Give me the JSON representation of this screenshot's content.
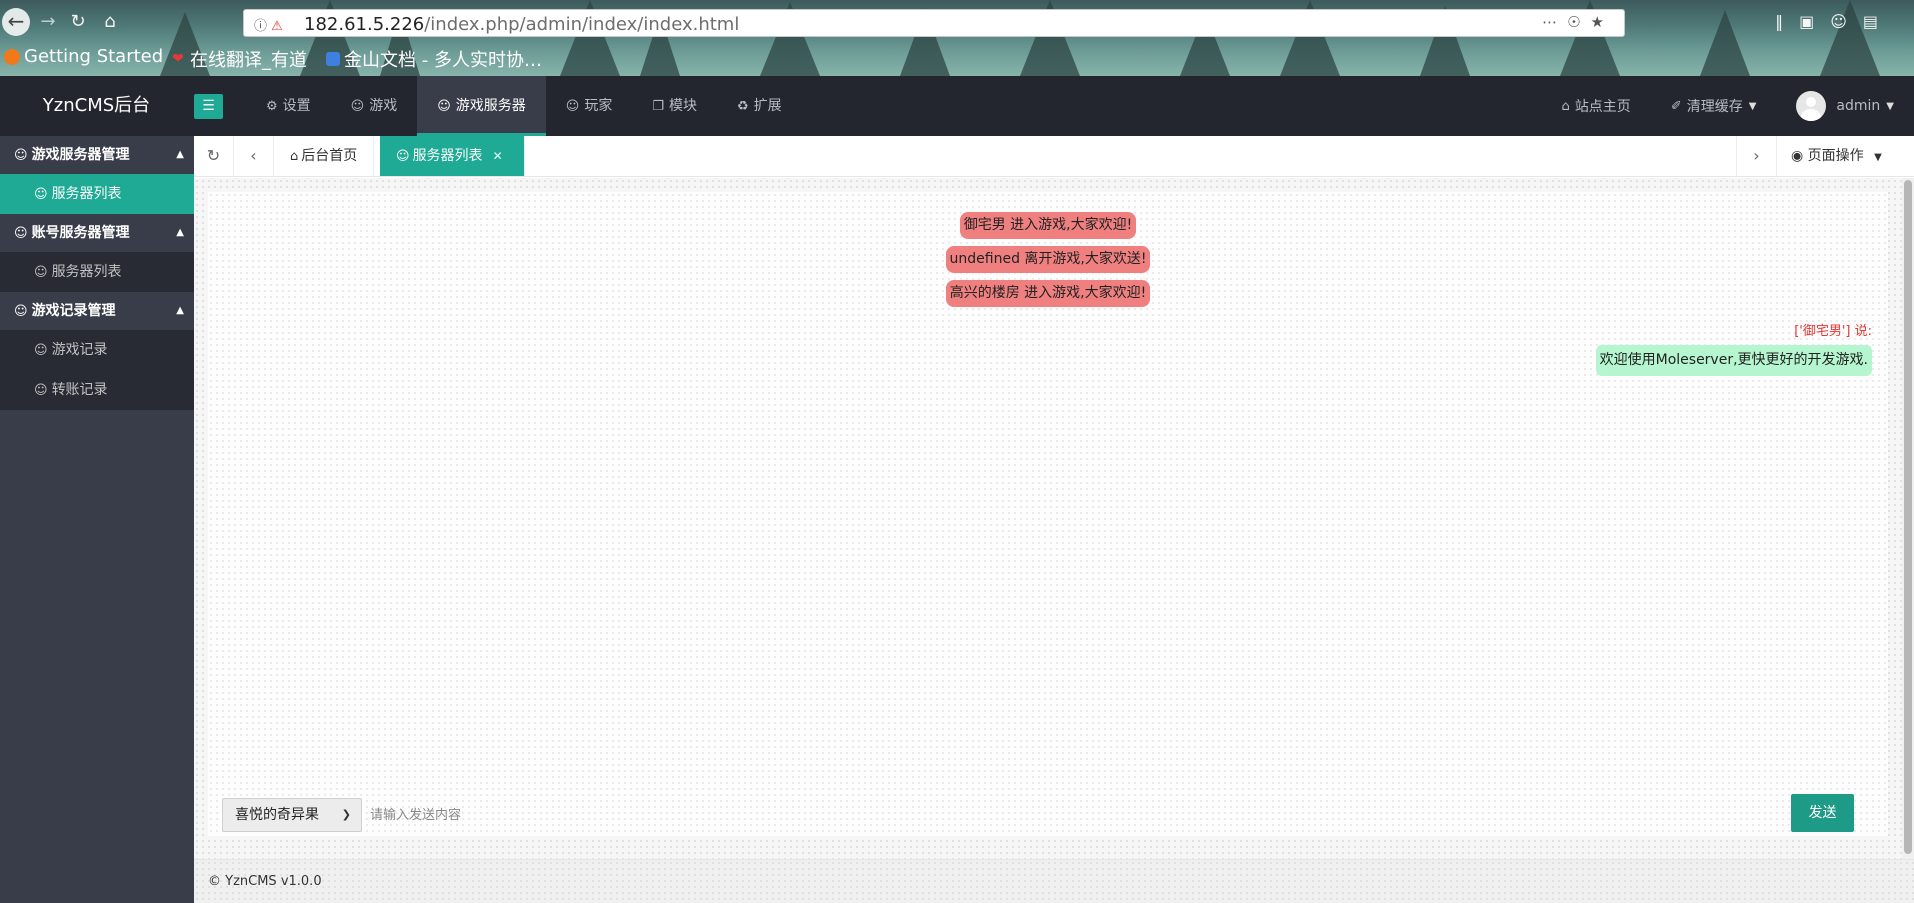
{
  "browser": {
    "url_host": "182.61.5.226",
    "url_path": "/index.php/admin/index/index.html",
    "bookmarks": [
      {
        "label": "Getting Started",
        "icon": "firefox-icon"
      },
      {
        "label": "在线翻译_有道",
        "icon": "youdao-icon"
      },
      {
        "label": "金山文档 - 多人实时协…",
        "icon": "kdocs-icon"
      }
    ]
  },
  "header": {
    "logo": "YznCMS后台",
    "nav": [
      {
        "label": "设置",
        "icon": "gear-icon"
      },
      {
        "label": "游戏",
        "icon": "user-icon"
      },
      {
        "label": "游戏服务器",
        "icon": "user-icon",
        "active": true
      },
      {
        "label": "玩家",
        "icon": "user-icon"
      },
      {
        "label": "模块",
        "icon": "cube-icon"
      },
      {
        "label": "扩展",
        "icon": "puzzle-icon"
      }
    ],
    "site_home": "站点主页",
    "clear_cache": "清理缓存",
    "username": "admin"
  },
  "sidebar": {
    "groups": [
      {
        "title": "游戏服务器管理",
        "items": [
          {
            "label": "服务器列表",
            "active": true
          }
        ]
      },
      {
        "title": "账号服务器管理",
        "items": [
          {
            "label": "服务器列表"
          }
        ]
      },
      {
        "title": "游戏记录管理",
        "items": [
          {
            "label": "游戏记录"
          },
          {
            "label": "转账记录"
          }
        ]
      }
    ]
  },
  "tabs": {
    "home": "后台首页",
    "current": "服务器列表",
    "page_ops": "页面操作"
  },
  "chat": {
    "system_messages": [
      "御宅男 进入游戏,大家欢迎!",
      "undefined 离开游戏,大家欢送!",
      "高兴的楼房 进入游戏,大家欢迎!"
    ],
    "speaker_line": "['御宅男'] 说:",
    "message": "欢迎使用Moleserver,更快更好的开发游戏.",
    "selected_user": "喜悦的奇异果",
    "input_placeholder": "请输入发送内容",
    "send_label": "发送"
  },
  "footer": {
    "text": "© YznCMS v1.0.0"
  },
  "colors": {
    "accent": "#1eaa94",
    "header_bg": "#23262e",
    "sidebar_bg": "#393d49",
    "system_msg_bg": "#f08080",
    "chat_bubble_bg": "#b5f5cf",
    "speaker_color": "#e53935"
  }
}
